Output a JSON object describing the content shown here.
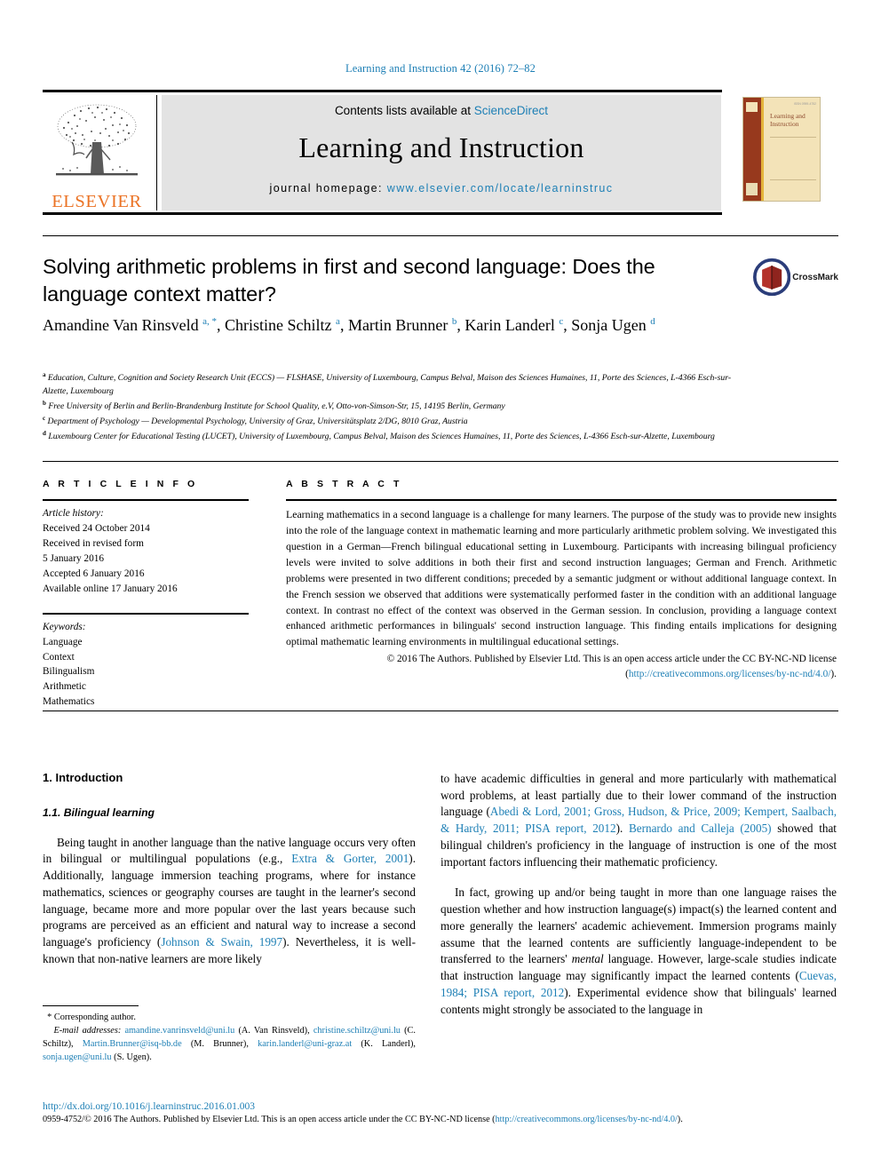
{
  "running_head": "Learning and Instruction 42 (2016) 72–82",
  "masthead": {
    "contents_prefix": "Contents lists available at ",
    "sciencedirect": "ScienceDirect",
    "journal_name": "Learning and Instruction",
    "homepage_prefix": "journal homepage: ",
    "homepage_url": "www.elsevier.com/locate/learninstruc",
    "publisher_wordmark": "ELSEVIER",
    "cover_title": "Learning and Instruction",
    "cover_corner_text": "ISSN 0959-4752"
  },
  "article": {
    "title": "Solving arithmetic problems in first and second language: Does the language context matter?",
    "crossmark_label": "CrossMark",
    "authors_html": "Amandine Van Rinsveld <sup>a, *</sup>, Christine Schiltz <sup>a</sup>, Martin Brunner <sup>b</sup>, Karin Landerl <sup>c</sup>, Sonja Ugen <sup>d</sup>",
    "affiliations": [
      {
        "marker": "a",
        "text": "Education, Culture, Cognition and Society Research Unit (ECCS) — FLSHASE, University of Luxembourg, Campus Belval, Maison des Sciences Humaines, 11, Porte des Sciences, L-4366 Esch-sur-Alzette, Luxembourg"
      },
      {
        "marker": "b",
        "text": "Free University of Berlin and Berlin-Brandenburg Institute for School Quality, e.V, Otto-von-Simson-Str, 15, 14195 Berlin, Germany"
      },
      {
        "marker": "c",
        "text": "Department of Psychology — Developmental Psychology, University of Graz, Universitätsplatz 2/DG, 8010 Graz, Austria"
      },
      {
        "marker": "d",
        "text": "Luxembourg Center for Educational Testing (LUCET), University of Luxembourg, Campus Belval, Maison des Sciences Humaines, 11, Porte des Sciences, L-4366 Esch-sur-Alzette, Luxembourg"
      }
    ]
  },
  "article_info": {
    "heading": "A R T I C L E   I N F O",
    "history_label": "Article history:",
    "history": [
      "Received 24 October 2014",
      "Received in revised form",
      "5 January 2016",
      "Accepted 6 January 2016",
      "Available online 17 January 2016"
    ],
    "keywords_label": "Keywords:",
    "keywords": [
      "Language",
      "Context",
      "Bilingualism",
      "Arithmetic",
      "Mathematics"
    ]
  },
  "abstract": {
    "heading": "A B S T R A C T",
    "text": "Learning mathematics in a second language is a challenge for many learners. The purpose of the study was to provide new insights into the role of the language context in mathematic learning and more particularly arithmetic problem solving. We investigated this question in a German—French bilingual educational setting in Luxembourg. Participants with increasing bilingual proficiency levels were invited to solve additions in both their first and second instruction languages; German and French. Arithmetic problems were presented in two different conditions; preceded by a semantic judgment or without additional language context. In the French session we observed that additions were systematically performed faster in the condition with an additional language context. In contrast no effect of the context was observed in the German session. In conclusion, providing a language context enhanced arithmetic performances in bilinguals' second instruction language. This finding entails implications for designing optimal mathematic learning environments in multilingual educational settings.",
    "copyright_text": "© 2016 The Authors. Published by Elsevier Ltd. This is an open access article under the CC BY-NC-ND license (",
    "copyright_link": "http://creativecommons.org/licenses/by-nc-nd/4.0/",
    "copyright_suffix": ")."
  },
  "body": {
    "section_heading": "1. Introduction",
    "subsection_heading": "1.1. Bilingual learning",
    "left_paragraph_1": {
      "part1": "Being taught in another language than the native language occurs very often in bilingual or multilingual populations (e.g., ",
      "ref1": "Extra & Gorter, 2001",
      "part2": "). Additionally, language immersion teaching programs, where for instance mathematics, sciences or geography courses are taught in the learner's second language, became more and more popular over the last years because such programs are perceived as an efficient and natural way to increase a second language's proficiency (",
      "ref2": "Johnson & Swain, 1997",
      "part3": "). Nevertheless, it is well-known that non-native learners are more likely"
    },
    "right_paragraph_1": {
      "part1": "to have academic difficulties in general and more particularly with mathematical word problems, at least partially due to their lower command of the instruction language (",
      "ref1": "Abedi & Lord, 2001; Gross, Hudson, & Price, 2009; Kempert, Saalbach, & Hardy, 2011; PISA report, 2012",
      "part2": "). ",
      "ref2": "Bernardo and Calleja (2005)",
      "part3": " showed that bilingual children's proficiency in the language of instruction is one of the most important factors influencing their mathematic proficiency."
    },
    "right_paragraph_2": {
      "part1": "In fact, growing up and/or being taught in more than one language raises the question whether and how instruction language(s) impact(s) the learned content and more generally the learners' academic achievement. Immersion programs mainly assume that the learned contents are sufficiently language-independent to be transferred to the learners' ",
      "em1": "mental",
      "part2": " language. However, large-scale studies indicate that instruction language may significantly impact the learned contents (",
      "ref1": "Cuevas, 1984; PISA report, 2012",
      "part2b": "). Experimental evidence show that bilinguals' learned contents might strongly be associated to the language in"
    }
  },
  "footnotes": {
    "corresponding": "* Corresponding author.",
    "email_label": "E-mail addresses:",
    "emails": [
      {
        "address": "amandine.vanrinsveld@uni.lu",
        "person": "(A. Van Rinsveld)"
      },
      {
        "address": "christine.schiltz@uni.lu",
        "person": "(C. Schiltz)"
      },
      {
        "address": "Martin.Brunner@isq-bb.de",
        "person": "(M. Brunner)"
      },
      {
        "address": "karin.landerl@uni-graz.at",
        "person": "(K. Landerl)"
      },
      {
        "address": "sonja.ugen@uni.lu",
        "person": "(S. Ugen)"
      }
    ]
  },
  "footer": {
    "doi": "http://dx.doi.org/10.1016/j.learninstruc.2016.01.003",
    "issn_text": "0959-4752/© 2016 The Authors. Published by Elsevier Ltd. This is an open access article under the CC BY-NC-ND license (",
    "issn_link": "http://creativecommons.org/licenses/by-nc-nd/4.0/",
    "issn_suffix": ")."
  },
  "colors": {
    "link": "#1d7fb5",
    "elsevier_orange": "#eb7325",
    "masthead_grey": "#e3e3e3",
    "cover_spine": "#97391d",
    "cover_body": "#f3e3b8"
  }
}
